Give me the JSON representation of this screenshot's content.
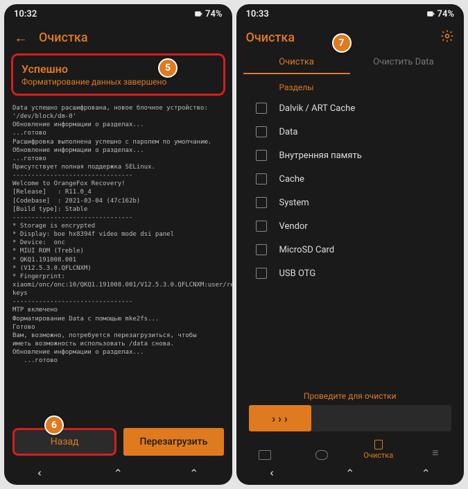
{
  "left": {
    "status_time": "10:32",
    "status_batt": "74%",
    "title": "Очистка",
    "success_title": "Успешно",
    "success_sub": "Форматирование данных завершено",
    "terminal": "Data успешно расшифрована, новое блочное устройство:\n'/dev/block/dm-0'\nОбновление информации о разделах...\n...готово\nРасшифровка выполнена успешно с паролем по умолчанию.\nОбновление информации о разделах...\n...готово\nПрисутствует полная поддержка SELinux.\n--------------------------------\nWelcome to OrangeFox Recovery!\n[Release]   : R11.0_4\n[Codebase]  : 2021-03-04 (47c162b)\n[Build type]: Stable\n--------------------------------\n* Storage is encrypted\n* Display: boe hx8394f video mode dsi panel\n* Device:  onc\n* MIUI ROM (Treble)\n* QKQ1.191008.001\n* (V12.5.3.0.QFLCNXM)\n* Fingerprint: xiaomi/onc/onc:10/QKQ1.191008.001/V12.5.3.0.QFLCNXM:user/release-keys\n--------------------------------\nMTP включено\nФорматирование Data с помощью mke2fs...\nГотово\nВам, возможно, потребуется перезагрузиться, чтобы\nиметь возможность использовать /data снова.\nОбновление информации о разделах...\n   ...готово",
    "btn_back": "Назад",
    "btn_reboot": "Перезагрузить"
  },
  "right": {
    "status_time": "10:33",
    "status_batt": "74%",
    "title": "Очистка",
    "tab_clean": "Очистка",
    "tab_data": "Очистить Data",
    "section": "Разделы",
    "items": [
      "Dalvik / ART Cache",
      "Data",
      "Внутренняя память",
      "Cache",
      "System",
      "Vendor",
      "MicroSD Card",
      "USB OTG"
    ],
    "swipe_label": "Проведите для очистки",
    "bottom_clean": "Очистка"
  },
  "badges": {
    "b5": "5",
    "b6": "6",
    "b7": "7"
  }
}
